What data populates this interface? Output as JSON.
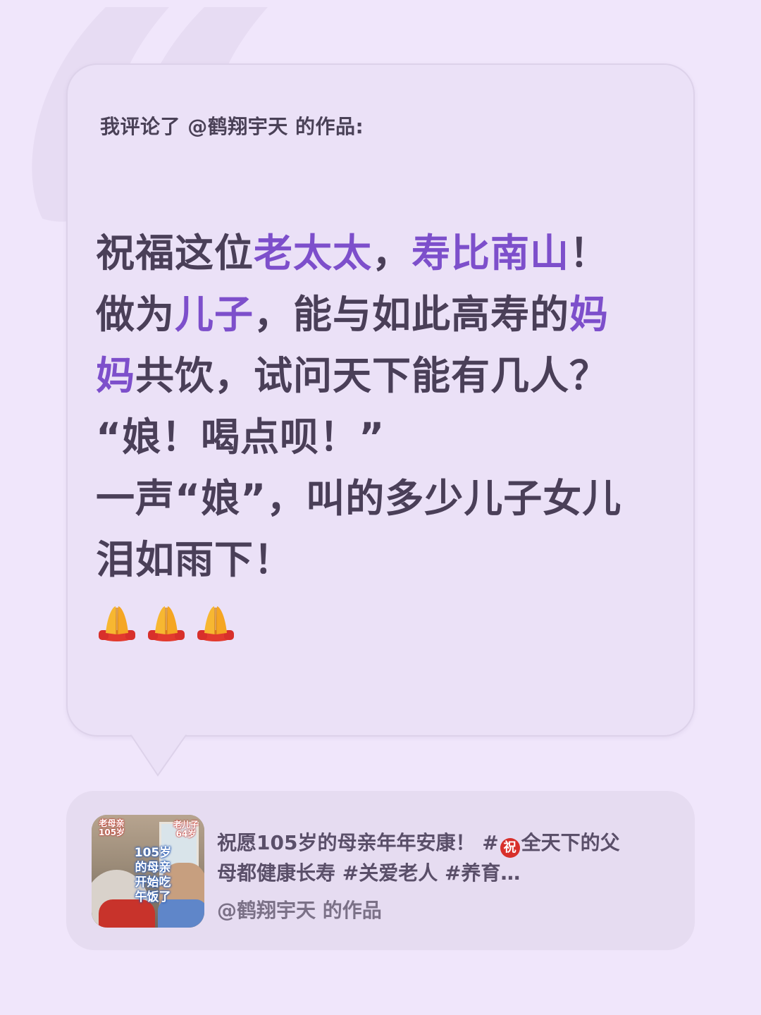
{
  "header": {
    "text": "我评论了 @鹤翔宇天 的作品:"
  },
  "comment": {
    "lines": [
      [
        {
          "t": "祝福这位"
        },
        {
          "t": "老太太",
          "hl": true
        },
        {
          "t": "，"
        },
        {
          "t": "寿比南山",
          "hl": true
        },
        {
          "t": "！"
        }
      ],
      [
        {
          "t": "做为"
        },
        {
          "t": "儿子",
          "hl": true
        },
        {
          "t": "，能与如此高寿的"
        },
        {
          "t": "妈",
          "hl": true
        }
      ],
      [
        {
          "t": "妈",
          "hl": true
        },
        {
          "t": "共饮，试问天下能有几人？"
        }
      ],
      [
        {
          "t": "“娘！喝点呗！”"
        }
      ],
      [
        {
          "t": "一声“娘”，叫的多少儿子女儿"
        }
      ],
      [
        {
          "t": "泪如雨下！"
        }
      ]
    ],
    "emoji_count": 3,
    "emoji_icon": "praying-hands-icon"
  },
  "work": {
    "desc_line1_a": "祝愿105岁的母亲年年安康！ #",
    "desc_zhu": "祝",
    "desc_line1_b": "全天下的父",
    "desc_line2": "母都健康长寿 #关爱老人 #养育…",
    "author": "@鹤翔宇天 的作品",
    "thumbnail": {
      "tag_left": "老母亲\n105岁",
      "tag_right": "老儿子\n64岁",
      "caption": "105岁\n的母亲\n开始吃\n午饭了"
    }
  },
  "colors": {
    "background": "#f0e6fb",
    "card": "#ebe1f7",
    "text": "#4a3f58",
    "highlight": "#7d4fcb"
  }
}
